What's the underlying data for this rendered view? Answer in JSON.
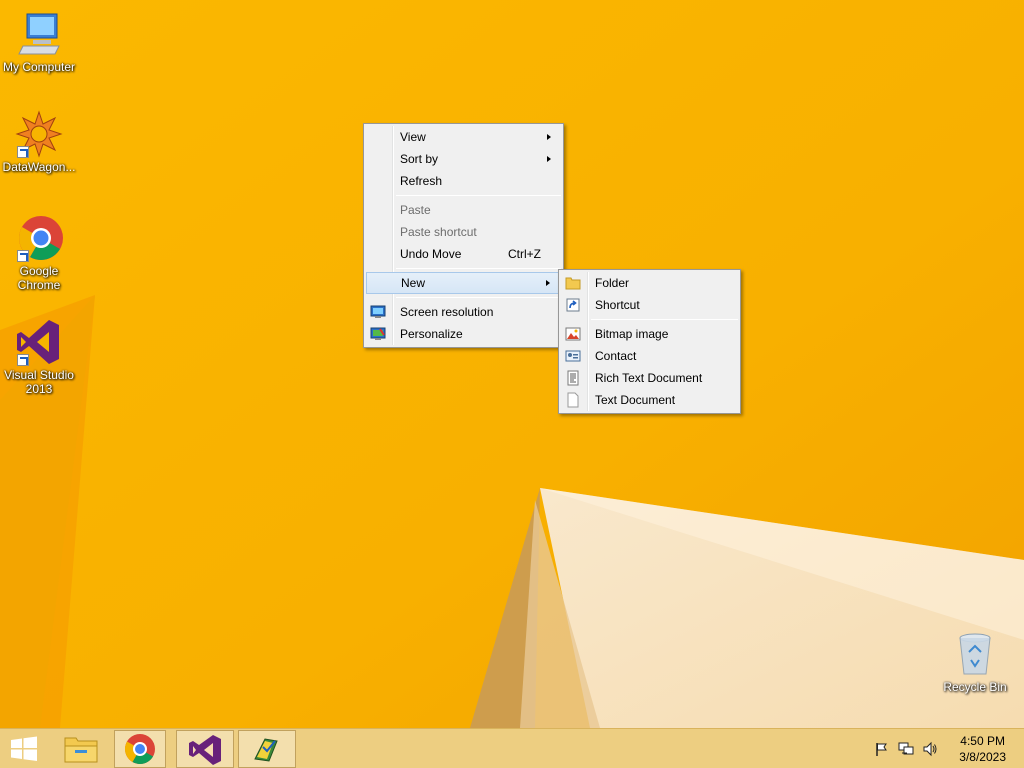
{
  "desktop": {
    "icons": [
      {
        "label": "My Computer"
      },
      {
        "label": "DataWagon..."
      },
      {
        "label_line1": "Google",
        "label_line2": "Chrome"
      },
      {
        "label_line1": "Visual Studio",
        "label_line2": "2013"
      },
      {
        "label": "Recycle Bin"
      }
    ]
  },
  "context_menu": {
    "items": {
      "view": "View",
      "sort_by": "Sort by",
      "refresh": "Refresh",
      "paste": "Paste",
      "paste_shortcut": "Paste shortcut",
      "undo_move": "Undo Move",
      "undo_move_shortcut": "Ctrl+Z",
      "new": "New",
      "screen_resolution": "Screen resolution",
      "personalize": "Personalize"
    }
  },
  "new_submenu": {
    "items": {
      "folder": "Folder",
      "shortcut": "Shortcut",
      "bitmap_image": "Bitmap image",
      "contact": "Contact",
      "rich_text_document": "Rich Text Document",
      "text_document": "Text Document"
    }
  },
  "taskbar": {
    "clock": {
      "time": "4:50 PM",
      "date": "3/8/2023"
    },
    "pinned": [
      "start-icon",
      "file-explorer-icon",
      "chrome-icon",
      "visual-studio-icon",
      "datawagon-app-icon"
    ]
  },
  "colors": {
    "wallpaper_orange": "#f7b500",
    "menu_background": "#f0f0f0",
    "menu_highlight": "#d6e6f6"
  }
}
